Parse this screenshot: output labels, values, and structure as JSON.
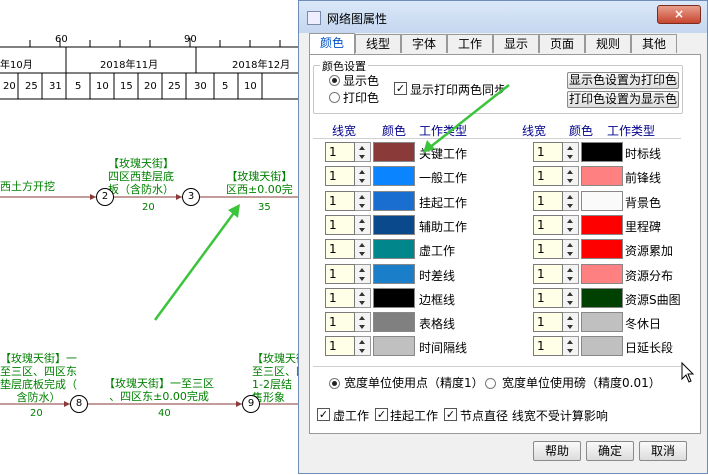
{
  "background": {
    "ruler_numbers": [
      "60",
      "90"
    ],
    "months": [
      "年10月",
      "2018年11月",
      "2018年12月"
    ],
    "days": [
      "20",
      "25",
      "31",
      "5",
      "10",
      "15",
      "20",
      "25",
      "30",
      "5",
      "10"
    ],
    "tasks": {
      "t1": "西土方开挖",
      "t2a": "【玫瑰天街】",
      "t2b": "四区西垫层底",
      "t2c": "板（含防水）",
      "t2_dur": "20",
      "t3a": "【玫瑰天街】",
      "t3b": "区西±0.00完",
      "t3_dur": "35",
      "t4a": "【玫瑰天街】一",
      "t4b": "至三区、四区东",
      "t4c": "垫层底板完成（",
      "t4d": "含防水）",
      "t4_dur": "20",
      "t5a": "【玫瑰天街】一至三区",
      "t5b": "、四区东±0.00完成",
      "t5_dur": "40",
      "t6a": "【玫瑰天街】",
      "t6b": "至三区、四",
      "t6c": "1-2层结",
      "t6d": "售形象"
    },
    "nodes": [
      "2",
      "3",
      "8",
      "9"
    ]
  },
  "dialog": {
    "title": "网络图属性",
    "close_label": "×",
    "tabs": [
      "颜色",
      "线型",
      "字体",
      "工作",
      "显示",
      "页面",
      "规则",
      "其他"
    ],
    "group_label": "颜色设置",
    "radio_display": "显示色",
    "radio_print": "打印色",
    "sync_label": "显示打印两色同步",
    "btn_display_to_print": "显示色设置为打印色",
    "btn_print_to_display": "打印色设置为显示色",
    "col_width": "线宽",
    "col_color": "颜色",
    "col_type": "工作类型",
    "left_rows": [
      {
        "width": "1",
        "color": "#8b3a3a",
        "label": "关键工作"
      },
      {
        "width": "1",
        "color": "#0a84ff",
        "label": "一般工作"
      },
      {
        "width": "1",
        "color": "#1a6ed0",
        "label": "挂起工作"
      },
      {
        "width": "1",
        "color": "#0a4a8c",
        "label": "辅助工作"
      },
      {
        "width": "1",
        "color": "#00868b",
        "label": "虚工作"
      },
      {
        "width": "1",
        "color": "#1a7ec8",
        "label": "时差线"
      },
      {
        "width": "1",
        "color": "#000000",
        "label": "边框线"
      },
      {
        "width": "1",
        "color": "#808080",
        "label": "表格线"
      },
      {
        "width": "1",
        "color": "#c0c0c0",
        "label": "时间隔线"
      }
    ],
    "right_rows": [
      {
        "width": "1",
        "color": "#000000",
        "label": "时标线"
      },
      {
        "width": "1",
        "color": "#ff8080",
        "label": "前锋线"
      },
      {
        "width": "1",
        "color": "#fafafa",
        "label": "背景色"
      },
      {
        "width": "1",
        "color": "#ff0000",
        "label": "里程碑"
      },
      {
        "width": "1",
        "color": "#ff0000",
        "label": "资源累加"
      },
      {
        "width": "1",
        "color": "#ff8080",
        "label": "资源分布"
      },
      {
        "width": "1",
        "color": "#004000",
        "label": "资源S曲图"
      },
      {
        "width": "1",
        "color": "#c0c0c0",
        "label": "冬休日"
      },
      {
        "width": "1",
        "color": "#c0c0c0",
        "label": "日延长段"
      }
    ],
    "unit_point": "宽度单位使用点（精度1）",
    "unit_mm": "宽度单位使用磅（精度0.01）",
    "chk_dummy": "虚工作",
    "chk_suspend": "挂起工作",
    "chk_node": "节点直径 线宽不受计算影响",
    "btn_help": "帮助",
    "btn_ok": "确定",
    "btn_cancel": "取消"
  }
}
